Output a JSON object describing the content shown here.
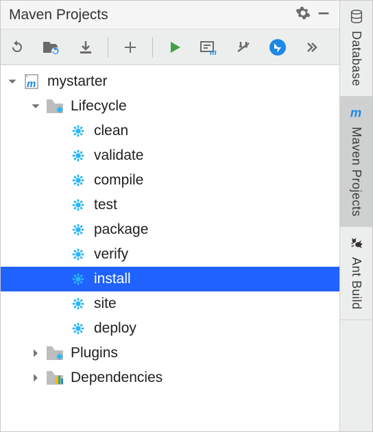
{
  "panel": {
    "title": "Maven Projects"
  },
  "tree": {
    "project": "mystarter",
    "groups": {
      "lifecycle_label": "Lifecycle",
      "plugins_label": "Plugins",
      "dependencies_label": "Dependencies"
    },
    "lifecycle": {
      "clean": "clean",
      "validate": "validate",
      "compile": "compile",
      "test": "test",
      "package": "package",
      "verify": "verify",
      "install": "install",
      "site": "site",
      "deploy": "deploy"
    },
    "selected": "install"
  },
  "side_tabs": {
    "database": "Database",
    "maven": "Maven Projects",
    "ant": "Ant Build"
  }
}
